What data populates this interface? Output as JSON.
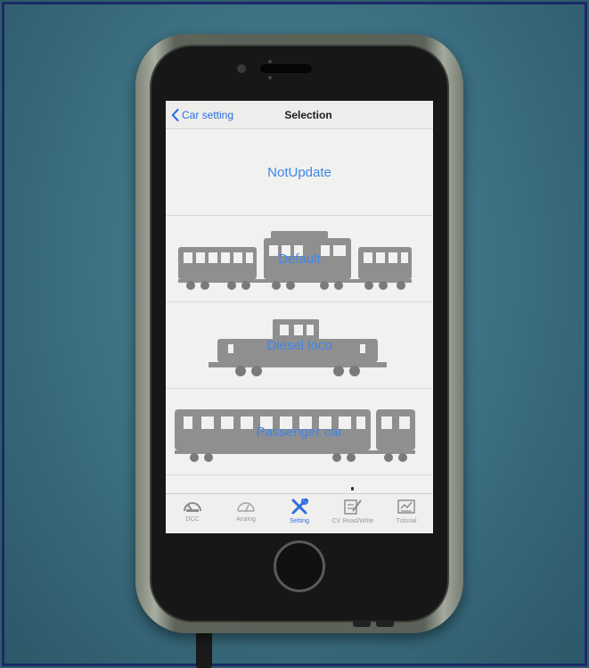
{
  "navbar": {
    "back_label": "Car setting",
    "title": "Selection"
  },
  "options": [
    {
      "label": "NotUpdate",
      "image": "none"
    },
    {
      "label": "Default",
      "image": "train-set"
    },
    {
      "label": "Diesel loco",
      "image": "diesel-locomotive"
    },
    {
      "label": "Passenger car",
      "image": "passenger-car"
    }
  ],
  "tabs": [
    {
      "label": "DCC",
      "icon": "dcc-gauge-icon",
      "active": false
    },
    {
      "label": "Analog",
      "icon": "analog-gauge-icon",
      "active": false
    },
    {
      "label": "Setting",
      "icon": "settings-tools-icon",
      "active": true
    },
    {
      "label": "CV Read/Write",
      "icon": "cv-edit-icon",
      "active": false
    },
    {
      "label": "Tutorial",
      "icon": "tutorial-icon",
      "active": false
    }
  ],
  "colors": {
    "accent": "#2c6fe0",
    "option_text": "#3f86e8",
    "background": "#2f5b6c"
  }
}
